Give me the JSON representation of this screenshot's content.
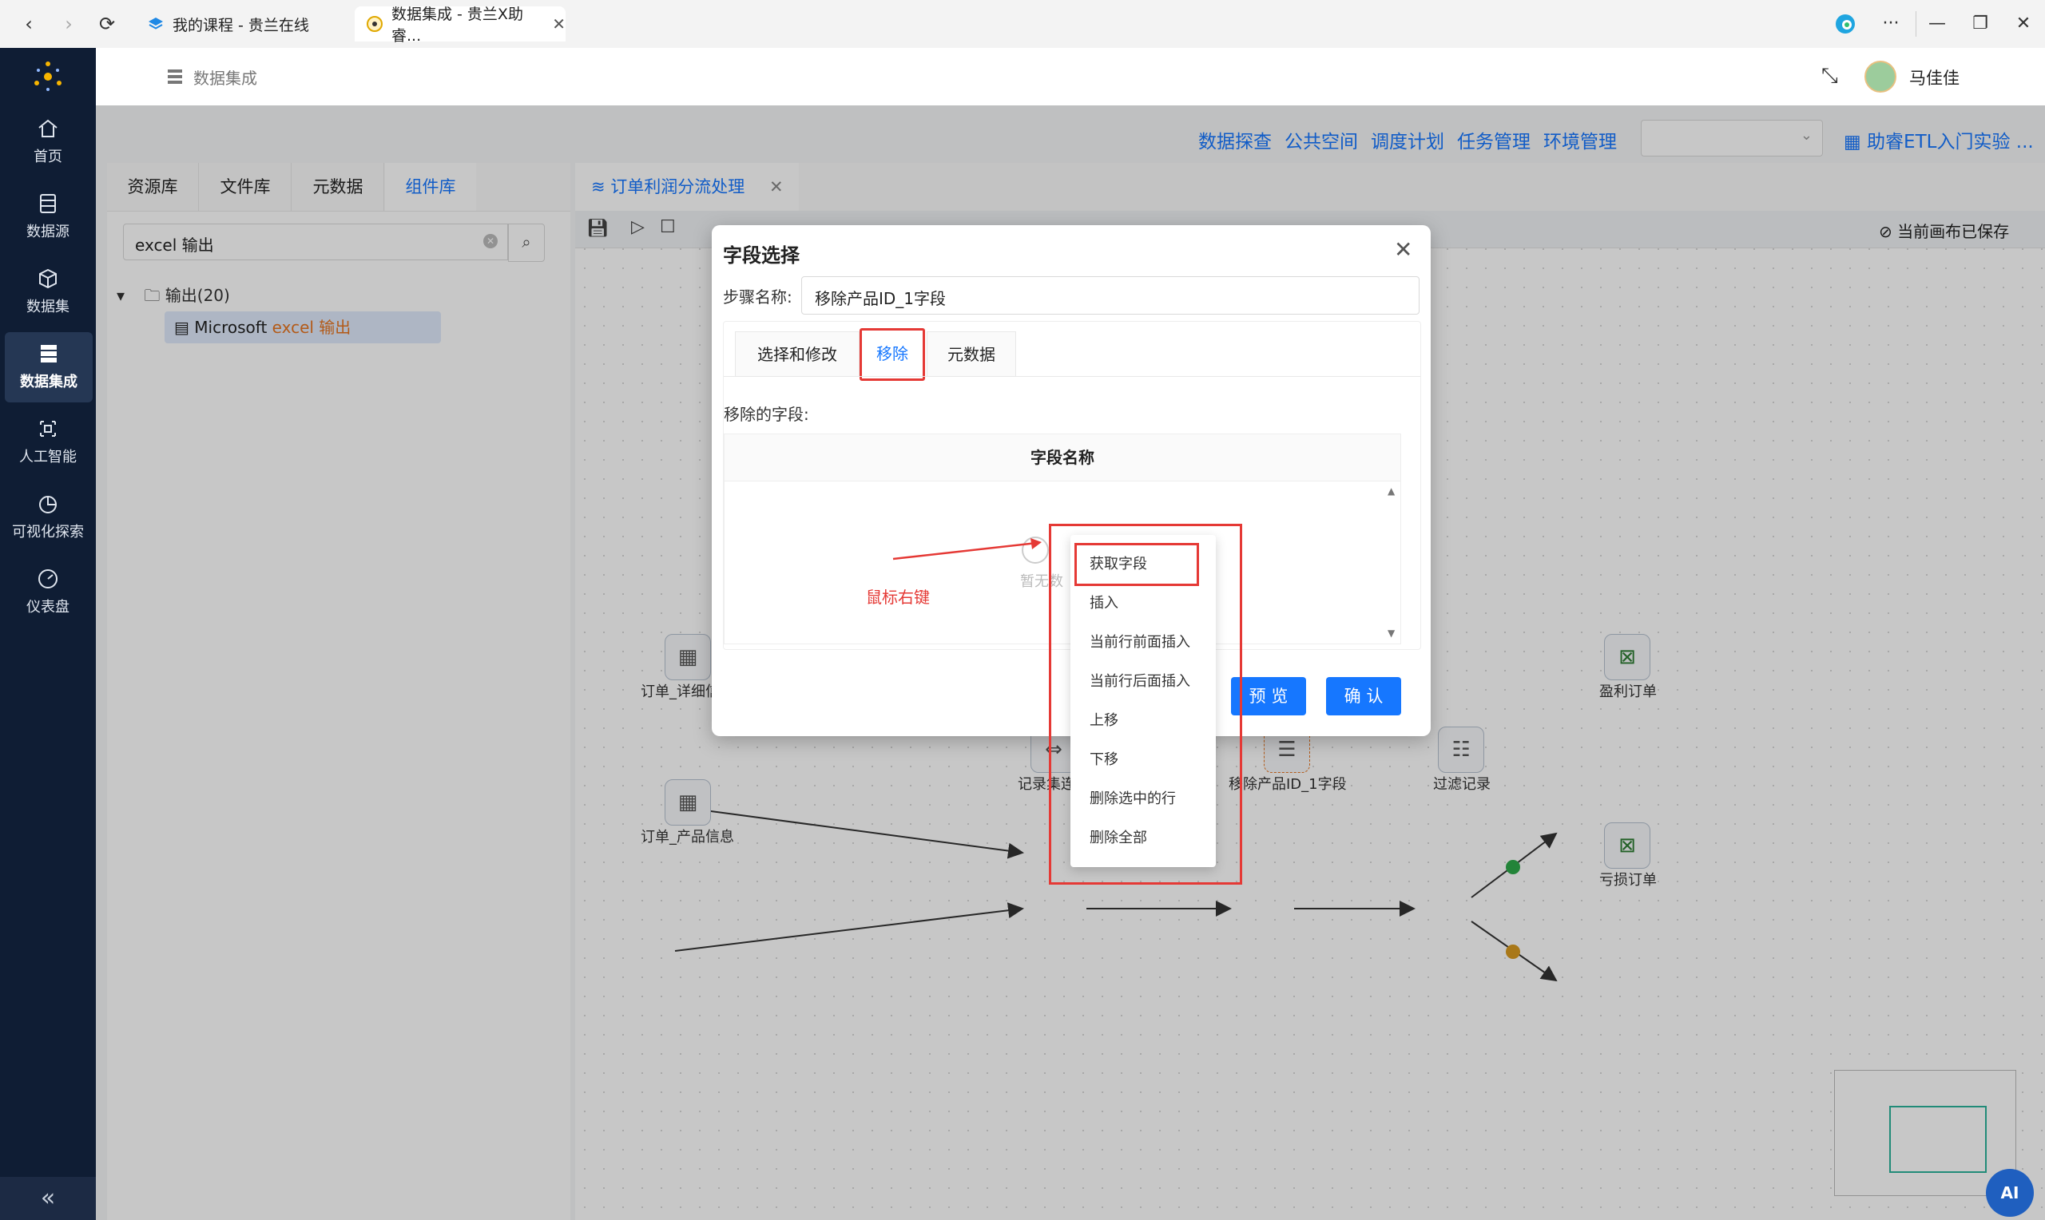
{
  "browser": {
    "tabs": [
      {
        "title": "我的课程 - 贵兰在线"
      },
      {
        "title": "数据集成 - 贵兰X助睿..."
      }
    ]
  },
  "sidebar": {
    "items": [
      {
        "label": "首页",
        "icon": "home-icon"
      },
      {
        "label": "数据源",
        "icon": "database-icon"
      },
      {
        "label": "数据集",
        "icon": "cube-icon"
      },
      {
        "label": "数据集成",
        "icon": "server-icon"
      },
      {
        "label": "人工智能",
        "icon": "ai-icon"
      },
      {
        "label": "可视化探索",
        "icon": "pie-chart-icon"
      },
      {
        "label": "仪表盘",
        "icon": "gauge-icon"
      }
    ],
    "collapse_label": "«"
  },
  "header": {
    "breadcrumb": "数据集成",
    "user_name": "马佳佳"
  },
  "toolbar": {
    "links": [
      "数据探查",
      "公共空间",
      "调度计划",
      "任务管理",
      "环境管理"
    ],
    "project": "助睿ETL入门实验 ..."
  },
  "left_panel": {
    "tabs": [
      "资源库",
      "文件库",
      "元数据",
      "组件库"
    ],
    "search_value": "excel 输出",
    "tree_folder": "输出(20)",
    "tree_item_prefix": "Microsoft ",
    "tree_item_highlight": "excel 输出"
  },
  "canvas": {
    "tab_title": "订单利润分流处理",
    "saved_status": "当前画布已保存",
    "nodes": {
      "order_detail": "订单_详细信",
      "order_product": "订单_产品信息",
      "record_join": "记录集连",
      "remove_field": "移除产品ID_1字段",
      "filter": "过滤记录",
      "profit": "盈利订单",
      "loss": "亏损订单"
    }
  },
  "dialog": {
    "title": "字段选择",
    "step_label": "步骤名称:",
    "step_value": "移除产品ID_1字段",
    "tabs": [
      "选择和修改",
      "移除",
      "元数据"
    ],
    "remove_label": "移除的字段:",
    "column_header": "字段名称",
    "empty_text": "暂无数",
    "btn_preview": "预 览",
    "btn_confirm": "确 认"
  },
  "annotation": {
    "text": "鼠标右键"
  },
  "context_menu": {
    "items": [
      "获取字段",
      "插入",
      "当前行前面插入",
      "当前行后面插入",
      "上移",
      "下移",
      "删除选中的行",
      "删除全部"
    ]
  },
  "colors": {
    "primary": "#1677ff",
    "sidebar": "#0f1d34",
    "annotation": "#e53935",
    "highlight": "#e6741f"
  }
}
